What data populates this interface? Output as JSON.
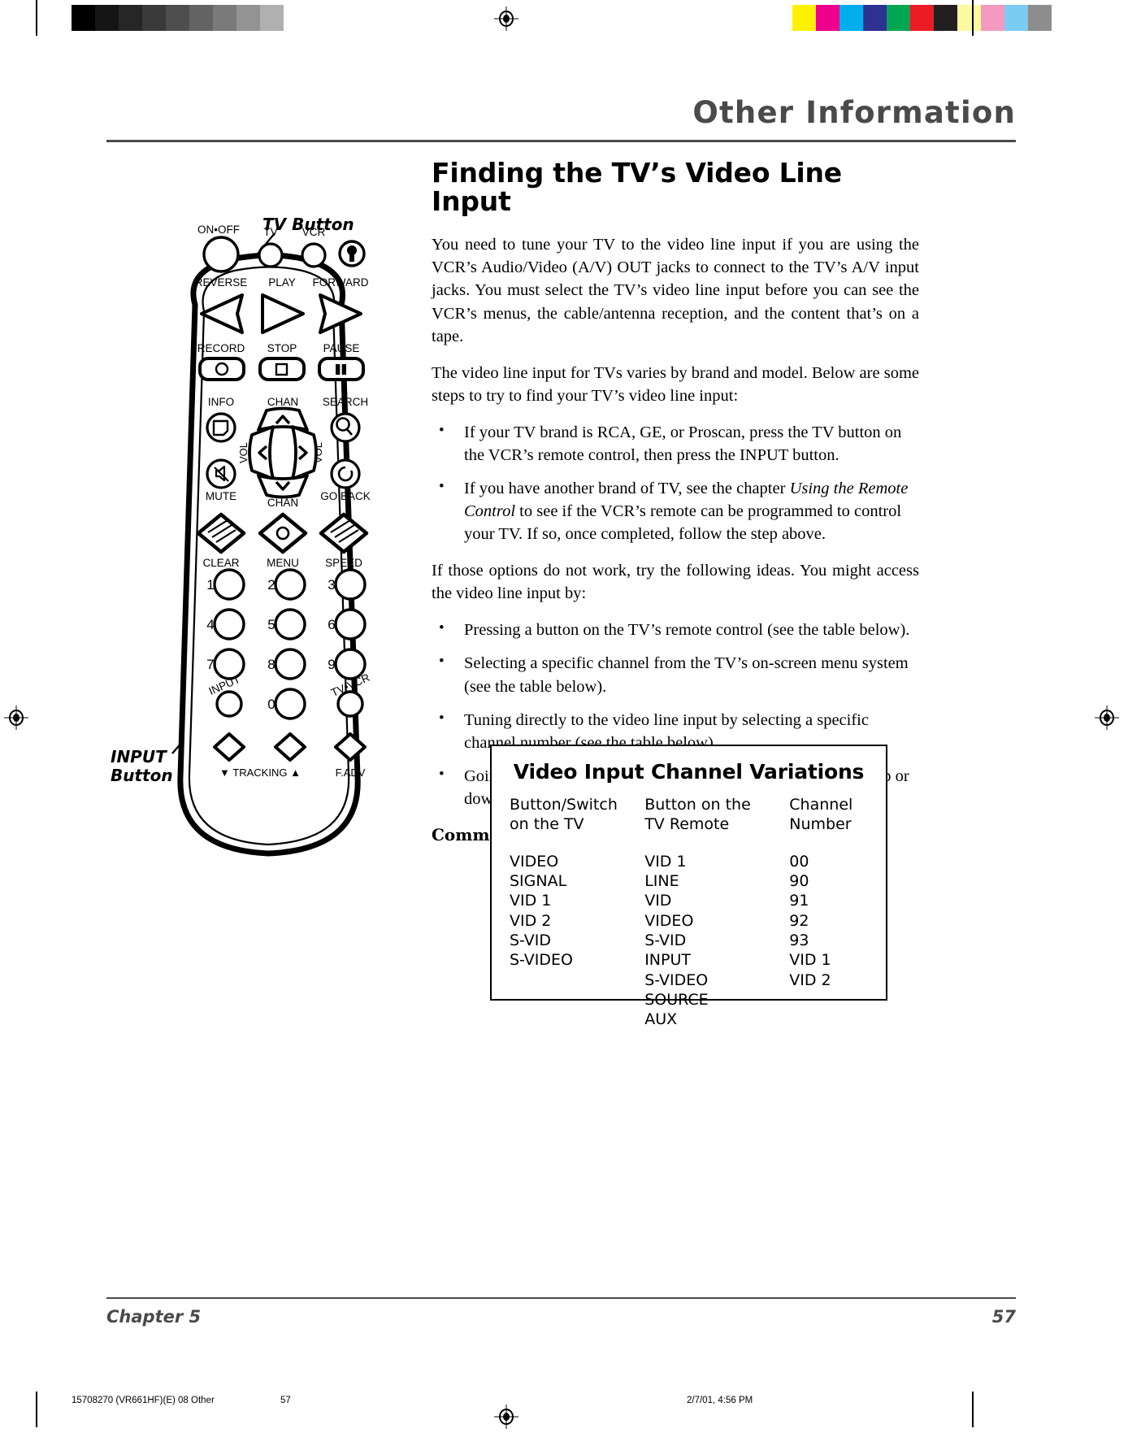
{
  "header": {
    "title": "Other Information"
  },
  "illustration": {
    "callout_tv": "TV Button",
    "callout_input_line1": "INPUT",
    "callout_input_line2": "Button",
    "remote_labels": {
      "on_off": "ON•OFF",
      "tv": "TV",
      "vcr": "VCR",
      "reverse": "REVERSE",
      "play": "PLAY",
      "forward": "FORWARD",
      "record": "RECORD",
      "stop": "STOP",
      "pause": "PAUSE",
      "info": "INFO",
      "chan_up": "CHAN",
      "search": "SEARCH",
      "vol_left": "VOL",
      "vol_right": "VOL",
      "mute": "MUTE",
      "chan_down": "CHAN",
      "go_back": "GO BACK",
      "clear": "CLEAR",
      "menu": "MENU",
      "speed": "SPEED",
      "num_1": "1",
      "num_2": "2",
      "num_3": "3",
      "num_4": "4",
      "num_5": "5",
      "num_6": "6",
      "num_7": "7",
      "num_8": "8",
      "num_9": "9",
      "num_0": "0",
      "input": "INPUT",
      "tv_vcr": "TV•VCR",
      "tracking": "▼ TRACKING ▲",
      "f_adv": "F.ADV"
    }
  },
  "main": {
    "section_title": "Finding the TV’s Video Line Input",
    "para1": "You need to tune your TV to the video line input if you are using the VCR’s Audio/Video (A/V) OUT jacks to connect to the TV’s A/V input jacks. You must select the TV’s video line input before you can see the VCR’s menus, the cable/antenna reception, and the content that’s on a tape.",
    "para2": "The video line input for TVs varies by brand and model. Below are some steps to try to find your TV’s video line input:",
    "bullet1": "If your TV brand is RCA, GE, or Proscan, press the TV button on the VCR’s remote control, then press the INPUT button.",
    "bullet2_pre": "If you have another brand of TV, see the chapter ",
    "bullet2_italic": "Using the Remote Control",
    "bullet2_post": " to see if the VCR’s remote can be programmed to control your TV. If so, once completed, follow the step above.",
    "para3": "If those options do not work, try the following ideas. You might access the video line input by:",
    "bullet3": "Pressing a button on the TV’s remote control (see the table below).",
    "bullet4": "Selecting a specific channel from the TV’s on-screen menu system (see the table below).",
    "bullet5": "Tuning directly to the video line input by selecting a specific channel number (see the table below)",
    "bullet6": "Going through all available channels by pressing the channel up or down buttons on the TV or its remote control.",
    "scenarios_label": "Common Video Line Input scenarios:"
  },
  "table": {
    "title": "Video Input Channel Variations",
    "headers": {
      "col1_line1": "Button/Switch",
      "col1_line2": "on the TV",
      "col2_line1": "Button on the",
      "col2_line2": "TV Remote",
      "col3_line1": "Channel",
      "col3_line2": "Number"
    },
    "col1": [
      "VIDEO",
      "SIGNAL",
      "VID 1",
      "VID 2",
      "S-VID",
      "S-VIDEO",
      "",
      ""
    ],
    "col2": [
      "VID 1",
      "LINE",
      "VID",
      "VIDEO",
      "S-VID",
      "INPUT",
      "S-VIDEO",
      "SOURCE",
      "AUX"
    ],
    "col3": [
      "00",
      "90",
      "91",
      "92",
      "93",
      "VID 1",
      "VID 2",
      "",
      ""
    ]
  },
  "footer": {
    "chapter": "Chapter 5",
    "page_number": "57"
  },
  "printline": {
    "file": "15708270 (VR661HF)(E) 08 Other",
    "page": "57",
    "date": "2/7/01, 4:56 PM"
  },
  "calibration": {
    "gray_swatches": [
      "#000000",
      "#151515",
      "#262626",
      "#3a3a3a",
      "#4e4e4e",
      "#636363",
      "#7a7a7a",
      "#939393",
      "#b0b0b0",
      "#ffffff"
    ],
    "color_swatches": [
      "#fff200",
      "#ec008c",
      "#00aeef",
      "#2e3192",
      "#00a651",
      "#ed1c24",
      "#231f20",
      "#fff9a0",
      "#f49ac1",
      "#7accf4",
      "#8d8d8d"
    ]
  }
}
